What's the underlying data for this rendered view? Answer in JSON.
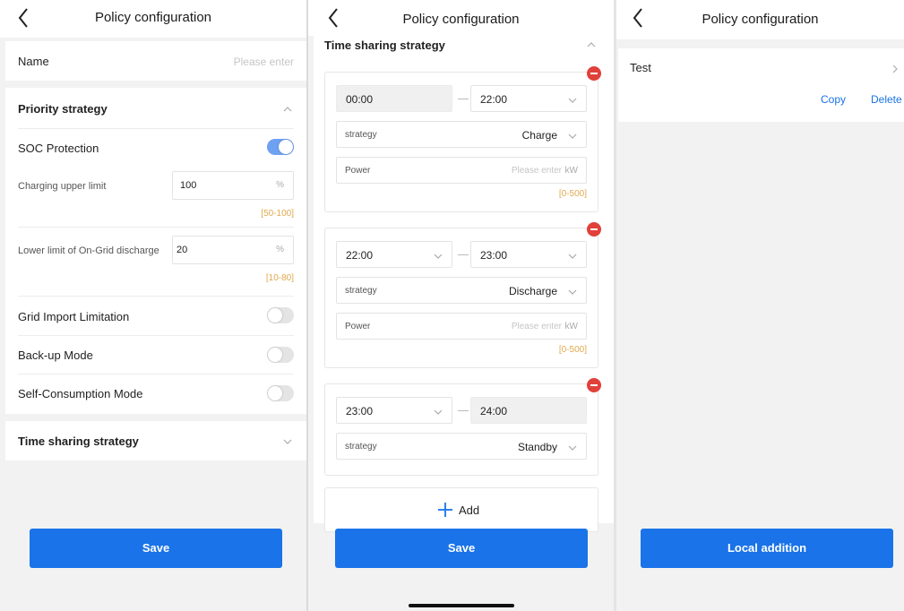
{
  "screen1": {
    "title": "Policy configuration",
    "name_label": "Name",
    "name_placeholder": "Please enter",
    "priority_section": "Priority strategy",
    "soc_protection": {
      "label": "SOC Protection",
      "on": true
    },
    "charging_upper": {
      "label": "Charging upper limit",
      "value": "100",
      "unit": "%",
      "range": "[50-100]"
    },
    "lower_discharge": {
      "label": "Lower limit of On-Grid discharge",
      "value": "20",
      "unit": "%",
      "range": "[10-80]"
    },
    "grid_import": {
      "label": "Grid Import Limitation",
      "on": false
    },
    "backup_mode": {
      "label": "Back-up Mode",
      "on": false
    },
    "self_consumption": {
      "label": "Self-Consumption Mode",
      "on": false
    },
    "time_section": "Time sharing strategy",
    "save_label": "Save"
  },
  "screen2": {
    "title": "Policy configuration",
    "section": "Time sharing strategy",
    "strategy_label": "strategy",
    "power_label": "Power",
    "power_placeholder": "Please enter",
    "power_unit": "kW",
    "power_range": "[0-500]",
    "periods": [
      {
        "start": "00:00",
        "end": "22:00",
        "strategy": "Charge"
      },
      {
        "start": "22:00",
        "end": "23:00",
        "strategy": "Discharge"
      },
      {
        "start": "23:00",
        "end": "24:00",
        "strategy": "Standby"
      }
    ],
    "add_label": "Add",
    "save_label": "Save"
  },
  "screen3": {
    "title": "Policy configuration",
    "item_name": "Test",
    "copy_label": "Copy",
    "delete_label": "Delete",
    "local_addition_label": "Local addition"
  },
  "colors": {
    "primary": "#1a73e8",
    "toggle_on": "#6ea1f2",
    "range": "#e0a94c",
    "remove": "#e0413a"
  }
}
